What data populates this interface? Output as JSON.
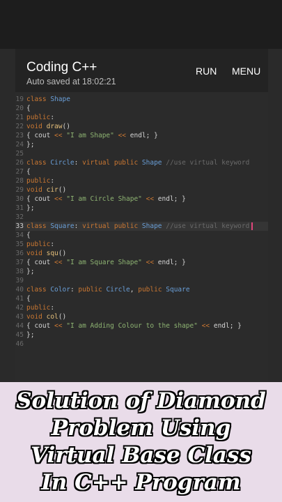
{
  "app": {
    "title": "Coding C++",
    "status": "Auto saved at 18:02:21",
    "run_label": "RUN",
    "menu_label": "MENU"
  },
  "editor": {
    "active_line": "33",
    "lines": [
      {
        "num": "19",
        "tokens": [
          [
            "kw",
            "class "
          ],
          [
            "ty",
            "Shape"
          ]
        ]
      },
      {
        "num": "20",
        "tokens": [
          [
            "",
            "{"
          ]
        ]
      },
      {
        "num": "21",
        "tokens": [
          [
            "kw",
            "public"
          ],
          [
            "",
            ":"
          ]
        ]
      },
      {
        "num": "22",
        "tokens": [
          [
            "kw",
            "void "
          ],
          [
            "fn",
            "draw"
          ],
          [
            "",
            "()"
          ]
        ]
      },
      {
        "num": "23",
        "tokens": [
          [
            "",
            "{ cout "
          ],
          [
            "kw",
            "<<"
          ],
          [
            "st",
            " \"I am Shape\" "
          ],
          [
            "kw",
            "<<"
          ],
          [
            "",
            " endl; }"
          ]
        ]
      },
      {
        "num": "24",
        "tokens": [
          [
            "",
            "};"
          ]
        ]
      },
      {
        "num": "25",
        "tokens": []
      },
      {
        "num": "26",
        "tokens": [
          [
            "kw",
            "class "
          ],
          [
            "ty",
            "Circle"
          ],
          [
            "",
            ": "
          ],
          [
            "kw",
            "virtual public "
          ],
          [
            "ty",
            "Shape "
          ],
          [
            "cm",
            "//use virtual keyword"
          ]
        ]
      },
      {
        "num": "27",
        "tokens": [
          [
            "",
            "{"
          ]
        ]
      },
      {
        "num": "28",
        "tokens": [
          [
            "kw",
            "public"
          ],
          [
            "",
            ":"
          ]
        ]
      },
      {
        "num": "29",
        "tokens": [
          [
            "kw",
            "void "
          ],
          [
            "fn",
            "cir"
          ],
          [
            "",
            "()"
          ]
        ]
      },
      {
        "num": "30",
        "tokens": [
          [
            "",
            "{ cout "
          ],
          [
            "kw",
            "<<"
          ],
          [
            "st",
            " \"I am Circle Shape\" "
          ],
          [
            "kw",
            "<<"
          ],
          [
            "",
            " endl; }"
          ]
        ]
      },
      {
        "num": "31",
        "tokens": [
          [
            "",
            "};"
          ]
        ]
      },
      {
        "num": "32",
        "tokens": []
      },
      {
        "num": "33",
        "tokens": [
          [
            "kw",
            "class "
          ],
          [
            "ty",
            "Square"
          ],
          [
            "",
            ": "
          ],
          [
            "kw",
            "virtual public "
          ],
          [
            "ty",
            "Shape "
          ],
          [
            "cm",
            "//use virtual keyword"
          ]
        ]
      },
      {
        "num": "34",
        "tokens": [
          [
            "",
            "{"
          ]
        ]
      },
      {
        "num": "35",
        "tokens": [
          [
            "kw",
            "public"
          ],
          [
            "",
            ":"
          ]
        ]
      },
      {
        "num": "36",
        "tokens": [
          [
            "kw",
            "void "
          ],
          [
            "fn",
            "squ"
          ],
          [
            "",
            "()"
          ]
        ]
      },
      {
        "num": "37",
        "tokens": [
          [
            "",
            "{ cout "
          ],
          [
            "kw",
            "<<"
          ],
          [
            "st",
            " \"I am Square Shape\" "
          ],
          [
            "kw",
            "<<"
          ],
          [
            "",
            " endl; }"
          ]
        ]
      },
      {
        "num": "38",
        "tokens": [
          [
            "",
            "};"
          ]
        ]
      },
      {
        "num": "39",
        "tokens": []
      },
      {
        "num": "40",
        "tokens": [
          [
            "kw",
            "class "
          ],
          [
            "ty",
            "Color"
          ],
          [
            "",
            ": "
          ],
          [
            "kw",
            "public "
          ],
          [
            "ty",
            "Circle"
          ],
          [
            "",
            ", "
          ],
          [
            "kw",
            "public "
          ],
          [
            "ty",
            "Square"
          ]
        ]
      },
      {
        "num": "41",
        "tokens": [
          [
            "",
            "{"
          ]
        ]
      },
      {
        "num": "42",
        "tokens": [
          [
            "kw",
            "public"
          ],
          [
            "",
            ":"
          ]
        ]
      },
      {
        "num": "43",
        "tokens": [
          [
            "kw",
            "void "
          ],
          [
            "fn",
            "col"
          ],
          [
            "",
            "()"
          ]
        ]
      },
      {
        "num": "44",
        "tokens": [
          [
            "",
            "{ cout "
          ],
          [
            "kw",
            "<<"
          ],
          [
            "st",
            " \"I am Adding Colour to the shape\" "
          ],
          [
            "kw",
            "<<"
          ],
          [
            "",
            " endl; }"
          ]
        ]
      },
      {
        "num": "45",
        "tokens": [
          [
            "",
            "};"
          ]
        ]
      },
      {
        "num": "46",
        "tokens": []
      }
    ]
  },
  "banner": {
    "lines": [
      "Solution of Diamond",
      "Problem Using",
      "Virtual Base Class",
      "In C++ Program"
    ]
  },
  "colors": {
    "keyword": "#cc7832",
    "type": "#6a9fd8",
    "function": "#e6c07b",
    "string": "#8fb573",
    "comment": "#6a6a6a",
    "cursor": "#e0457b",
    "banner_bg": "#e9dce9"
  }
}
